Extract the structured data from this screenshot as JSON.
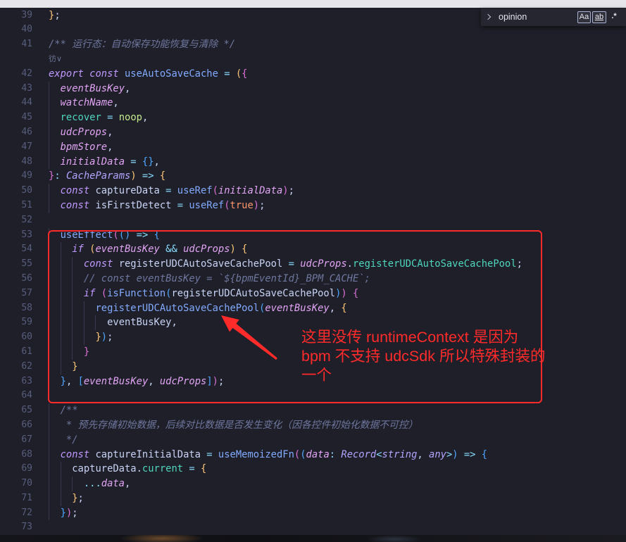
{
  "colors": {
    "editor_background": "#1e1f28",
    "annotation_red": "#ff2b2b"
  },
  "find_widget": {
    "toggle_icon": "chevron-right-icon",
    "query": "opinion",
    "match_case_label": "Aa",
    "whole_word_label": "ab",
    "regex_label": ".*"
  },
  "annotation": {
    "lines": [
      "这里没传 runtimeContext 是因为",
      "bpm 不支持 udcSdk 所以特殊封装的",
      "一个"
    ]
  },
  "editor": {
    "lines": [
      {
        "n": "39",
        "code": [
          {
            "y": "}"
          },
          {
            "p": ";"
          }
        ]
      },
      {
        "n": "40",
        "code": []
      },
      {
        "n": "41",
        "code": [
          {
            "c": "/** 运行态：自动保存功能恢复与清除 */"
          }
        ]
      },
      {
        "lens": "彷∨"
      },
      {
        "n": "42",
        "code": [
          {
            "k": "export "
          },
          {
            "k": "const "
          },
          {
            "f": "useAutoSaveCache"
          },
          {
            "o": " = "
          },
          {
            "y": "("
          },
          {
            "m": "{"
          }
        ]
      },
      {
        "n": "43",
        "code": [
          {
            "p": "  "
          },
          {
            "a": "eventBusKey"
          },
          {
            "p": ","
          }
        ]
      },
      {
        "n": "44",
        "code": [
          {
            "p": "  "
          },
          {
            "a": "watchName"
          },
          {
            "p": ","
          }
        ]
      },
      {
        "n": "45",
        "code": [
          {
            "p": "  "
          },
          {
            "r": "recover"
          },
          {
            "o": " = "
          },
          {
            "g": "noop"
          },
          {
            "p": ","
          }
        ]
      },
      {
        "n": "46",
        "code": [
          {
            "p": "  "
          },
          {
            "a": "udcProps"
          },
          {
            "p": ","
          }
        ]
      },
      {
        "n": "47",
        "code": [
          {
            "p": "  "
          },
          {
            "a": "bpmStore"
          },
          {
            "p": ","
          }
        ]
      },
      {
        "n": "48",
        "code": [
          {
            "p": "  "
          },
          {
            "a": "initialData"
          },
          {
            "o": " = "
          },
          {
            "u": "{}"
          },
          {
            "p": ","
          }
        ]
      },
      {
        "n": "49",
        "code": [
          {
            "m": "}"
          },
          {
            "o": ": "
          },
          {
            "t": "CacheParams"
          },
          {
            "y": ")"
          },
          {
            "o": " => "
          },
          {
            "y": "{"
          }
        ]
      },
      {
        "n": "50",
        "code": [
          {
            "p": "  "
          },
          {
            "k": "const "
          },
          {
            "v": "captureData"
          },
          {
            "o": " = "
          },
          {
            "f": "useRef"
          },
          {
            "m": "("
          },
          {
            "a": "initialData"
          },
          {
            "m": ")"
          },
          {
            "p": ";"
          }
        ]
      },
      {
        "n": "51",
        "code": [
          {
            "p": "  "
          },
          {
            "k": "const "
          },
          {
            "v": "isFirstDetect"
          },
          {
            "o": " = "
          },
          {
            "f": "useRef"
          },
          {
            "m": "("
          },
          {
            "b": "true"
          },
          {
            "m": ")"
          },
          {
            "p": ";"
          }
        ]
      },
      {
        "n": "52",
        "code": []
      },
      {
        "n": "53",
        "code": [
          {
            "p": "  "
          },
          {
            "f": "useEffect"
          },
          {
            "m": "("
          },
          {
            "u": "()"
          },
          {
            "o": " => "
          },
          {
            "u": "{"
          }
        ]
      },
      {
        "n": "54",
        "code": [
          {
            "p": "    "
          },
          {
            "k": "if "
          },
          {
            "y": "("
          },
          {
            "a": "eventBusKey"
          },
          {
            "o": " && "
          },
          {
            "a": "udcProps"
          },
          {
            "y": ")"
          },
          {
            "p": " "
          },
          {
            "y": "{"
          }
        ]
      },
      {
        "n": "55",
        "code": [
          {
            "p": "      "
          },
          {
            "k": "const "
          },
          {
            "v": "registerUDCAutoSaveCachePool"
          },
          {
            "o": " = "
          },
          {
            "a": "udcProps"
          },
          {
            "p": "."
          },
          {
            "r": "registerUDCAutoSaveCachePool"
          },
          {
            "p": ";"
          }
        ]
      },
      {
        "n": "56",
        "code": [
          {
            "p": "      "
          },
          {
            "c": "// const eventBusKey = `${bpmEventId}_BPM_CACHE`;"
          }
        ]
      },
      {
        "n": "57",
        "code": [
          {
            "p": "      "
          },
          {
            "k": "if "
          },
          {
            "m": "("
          },
          {
            "f": "isFunction"
          },
          {
            "u": "("
          },
          {
            "v": "registerUDCAutoSaveCachePool"
          },
          {
            "u": ")"
          },
          {
            "m": ")"
          },
          {
            "p": " "
          },
          {
            "m": "{"
          }
        ]
      },
      {
        "n": "58",
        "code": [
          {
            "p": "        "
          },
          {
            "f": "registerUDCAutoSaveCachePool"
          },
          {
            "u": "("
          },
          {
            "a": "eventBusKey"
          },
          {
            "p": ", "
          },
          {
            "y": "{"
          }
        ]
      },
      {
        "n": "59",
        "code": [
          {
            "p": "          "
          },
          {
            "v": "eventBusKey"
          },
          {
            "p": ","
          }
        ]
      },
      {
        "n": "60",
        "code": [
          {
            "p": "        "
          },
          {
            "y": "}"
          },
          {
            "u": ")"
          },
          {
            "p": ";"
          }
        ]
      },
      {
        "n": "61",
        "code": [
          {
            "p": "      "
          },
          {
            "m": "}"
          }
        ]
      },
      {
        "n": "62",
        "code": [
          {
            "p": "    "
          },
          {
            "y": "}"
          }
        ]
      },
      {
        "n": "63",
        "code": [
          {
            "p": "  "
          },
          {
            "u": "}"
          },
          {
            "p": ", "
          },
          {
            "u": "["
          },
          {
            "a": "eventBusKey"
          },
          {
            "p": ", "
          },
          {
            "a": "udcProps"
          },
          {
            "u": "]"
          },
          {
            "m": ")"
          },
          {
            "p": ";"
          }
        ]
      },
      {
        "n": "64",
        "code": []
      },
      {
        "n": "65",
        "code": [
          {
            "p": "  "
          },
          {
            "c": "/**"
          }
        ]
      },
      {
        "n": "66",
        "code": [
          {
            "p": "   "
          },
          {
            "c": "* 预先存储初始数据，后续对比数据是否发生变化（因各控件初始化数据不可控）"
          }
        ]
      },
      {
        "n": "67",
        "code": [
          {
            "p": "   "
          },
          {
            "c": "*/"
          }
        ]
      },
      {
        "n": "68",
        "code": [
          {
            "p": "  "
          },
          {
            "k": "const "
          },
          {
            "v": "captureInitialData"
          },
          {
            "o": " = "
          },
          {
            "f": "useMemoizedFn"
          },
          {
            "m": "("
          },
          {
            "u": "("
          },
          {
            "a": "data"
          },
          {
            "o": ": "
          },
          {
            "t": "Record"
          },
          {
            "o": "<"
          },
          {
            "t": "string"
          },
          {
            "p": ", "
          },
          {
            "t": "any"
          },
          {
            "o": ">"
          },
          {
            "u": ")"
          },
          {
            "o": " => "
          },
          {
            "u": "{"
          }
        ]
      },
      {
        "n": "69",
        "code": [
          {
            "p": "    "
          },
          {
            "v": "captureData"
          },
          {
            "p": "."
          },
          {
            "r": "current"
          },
          {
            "o": " = "
          },
          {
            "y": "{"
          }
        ]
      },
      {
        "n": "70",
        "code": [
          {
            "p": "      "
          },
          {
            "o": "..."
          },
          {
            "a": "data"
          },
          {
            "p": ","
          }
        ]
      },
      {
        "n": "71",
        "code": [
          {
            "p": "    "
          },
          {
            "y": "}"
          },
          {
            "p": ";"
          }
        ]
      },
      {
        "n": "72",
        "code": [
          {
            "p": "  "
          },
          {
            "u": "}"
          },
          {
            "m": ")"
          },
          {
            "p": ";"
          }
        ]
      },
      {
        "n": "73",
        "code": []
      }
    ]
  }
}
